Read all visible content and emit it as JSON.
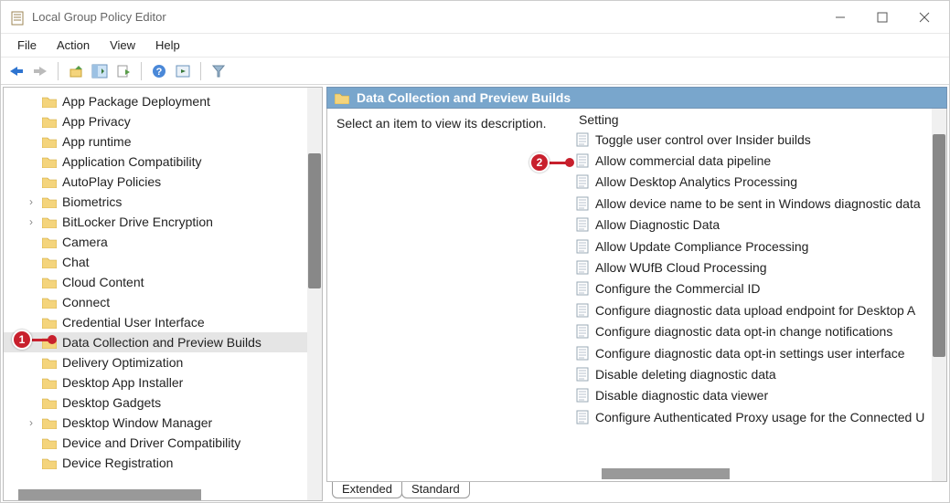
{
  "window": {
    "title": "Local Group Policy Editor"
  },
  "menu": {
    "file": "File",
    "action": "Action",
    "view": "View",
    "help": "Help"
  },
  "tree": {
    "items": [
      {
        "label": "App Package Deployment",
        "expander": false,
        "selected": false
      },
      {
        "label": "App Privacy",
        "expander": false,
        "selected": false
      },
      {
        "label": "App runtime",
        "expander": false,
        "selected": false
      },
      {
        "label": "Application Compatibility",
        "expander": false,
        "selected": false
      },
      {
        "label": "AutoPlay Policies",
        "expander": false,
        "selected": false
      },
      {
        "label": "Biometrics",
        "expander": true,
        "selected": false
      },
      {
        "label": "BitLocker Drive Encryption",
        "expander": true,
        "selected": false
      },
      {
        "label": "Camera",
        "expander": false,
        "selected": false
      },
      {
        "label": "Chat",
        "expander": false,
        "selected": false
      },
      {
        "label": "Cloud Content",
        "expander": false,
        "selected": false
      },
      {
        "label": "Connect",
        "expander": false,
        "selected": false
      },
      {
        "label": "Credential User Interface",
        "expander": false,
        "selected": false
      },
      {
        "label": "Data Collection and Preview Builds",
        "expander": false,
        "selected": true
      },
      {
        "label": "Delivery Optimization",
        "expander": false,
        "selected": false
      },
      {
        "label": "Desktop App Installer",
        "expander": false,
        "selected": false
      },
      {
        "label": "Desktop Gadgets",
        "expander": false,
        "selected": false
      },
      {
        "label": "Desktop Window Manager",
        "expander": true,
        "selected": false
      },
      {
        "label": "Device and Driver Compatibility",
        "expander": false,
        "selected": false
      },
      {
        "label": "Device Registration",
        "expander": false,
        "selected": false
      }
    ]
  },
  "right": {
    "header": "Data Collection and Preview Builds",
    "description": "Select an item to view its description.",
    "setting_header": "Setting",
    "settings": [
      "Toggle user control over Insider builds",
      "Allow commercial data pipeline",
      "Allow Desktop Analytics Processing",
      "Allow device name to be sent in Windows diagnostic data",
      "Allow Diagnostic Data",
      "Allow Update Compliance Processing",
      "Allow WUfB Cloud Processing",
      "Configure the Commercial ID",
      "Configure diagnostic data upload endpoint for Desktop A",
      "Configure diagnostic data opt-in change notifications",
      "Configure diagnostic data opt-in settings user interface",
      "Disable deleting diagnostic data",
      "Disable diagnostic data viewer",
      "Configure Authenticated Proxy usage for the Connected U"
    ]
  },
  "tabs": {
    "extended": "Extended",
    "standard": "Standard"
  },
  "badges": {
    "b1": "1",
    "b2": "2"
  }
}
